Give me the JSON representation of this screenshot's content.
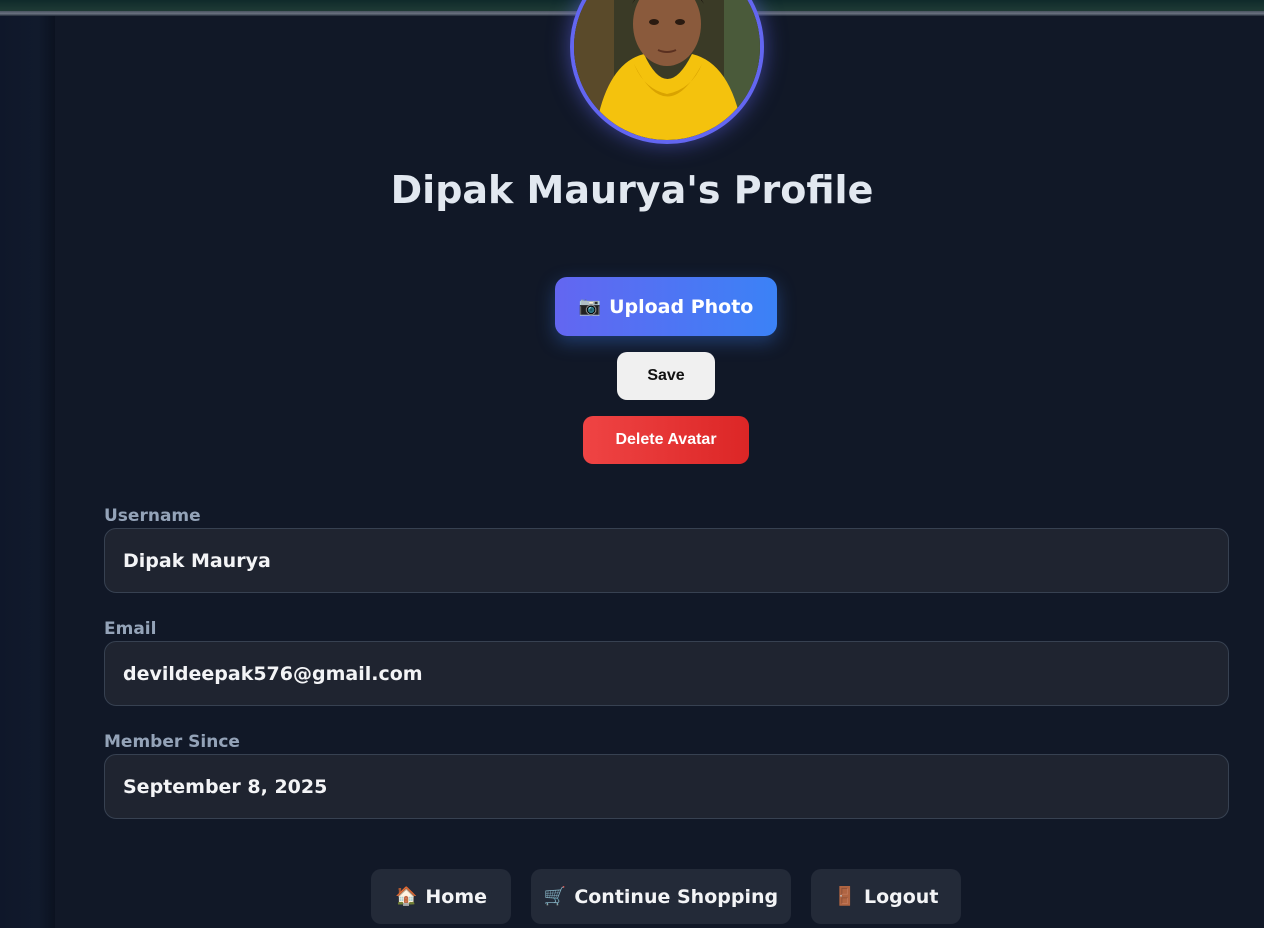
{
  "profile": {
    "title": "Dipak Maurya's Profile",
    "avatar_alt": "profile-avatar"
  },
  "actions": {
    "upload_icon": "📷",
    "upload_label": "Upload Photo",
    "save_label": "Save",
    "delete_label": "Delete Avatar"
  },
  "fields": {
    "username_label": "Username",
    "username_value": "Dipak Maurya",
    "email_label": "Email",
    "email_value": "devildeepak576@gmail.com",
    "member_label": "Member Since",
    "member_value": "September 8, 2025"
  },
  "nav": {
    "home_icon": "🏠",
    "home_label": "Home",
    "shop_icon": "🛒",
    "shop_label": "Continue Shopping",
    "logout_icon": "🚪",
    "logout_label": "Logout"
  },
  "colors": {
    "accent": "#6366f1",
    "upload_end": "#3b82f6",
    "danger": "#ef4444",
    "background": "#111827"
  }
}
